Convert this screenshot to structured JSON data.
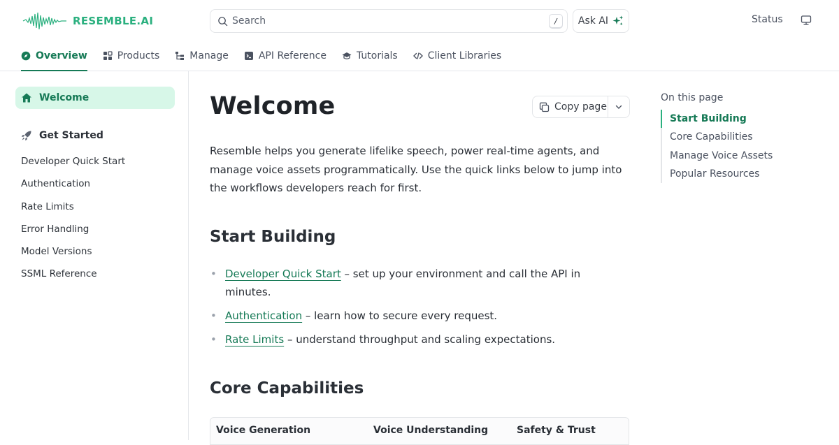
{
  "header": {
    "logo_text": "RESEMBLE.AI",
    "search": {
      "placeholder": "Search",
      "shortcut": "/"
    },
    "ask_ai_label": "Ask AI",
    "status_label": "Status"
  },
  "tabs": [
    {
      "label": "Overview",
      "icon": "compass-icon",
      "active": true
    },
    {
      "label": "Products",
      "icon": "grid-icon"
    },
    {
      "label": "Manage",
      "icon": "tree-icon"
    },
    {
      "label": "API Reference",
      "icon": "terminal-icon"
    },
    {
      "label": "Tutorials",
      "icon": "graduation-cap-icon"
    },
    {
      "label": "Client Libraries",
      "icon": "code-icon"
    }
  ],
  "sidebar": {
    "welcome_label": "Welcome",
    "section_label": "Get Started",
    "links": [
      "Developer Quick Start",
      "Authentication",
      "Rate Limits",
      "Error Handling",
      "Model Versions",
      "SSML Reference"
    ]
  },
  "main": {
    "title": "Welcome",
    "copy_label": "Copy page",
    "intro": "Resemble helps you generate lifelike speech, power real-time agents, and manage voice assets programmatically. Use the quick links below to jump into the workflows developers reach for first.",
    "start_building_heading": "Start Building",
    "bullets": [
      {
        "link": "Developer Quick Start",
        "text": " – set up your environment and call the API in minutes."
      },
      {
        "link": "Authentication",
        "text": " – learn how to secure every request."
      },
      {
        "link": "Rate Limits",
        "text": " – understand throughput and scaling expectations."
      }
    ],
    "core_heading": "Core Capabilities",
    "table_headers": [
      "Voice Generation",
      "Voice Understanding",
      "Safety & Trust"
    ]
  },
  "toc": {
    "title": "On this page",
    "items": [
      "Start Building",
      "Core Capabilities",
      "Manage Voice Assets",
      "Popular Resources"
    ]
  },
  "colors": {
    "accent": "#167a56",
    "accent_light": "#d7f7e8",
    "logo": "#2bb07f"
  }
}
